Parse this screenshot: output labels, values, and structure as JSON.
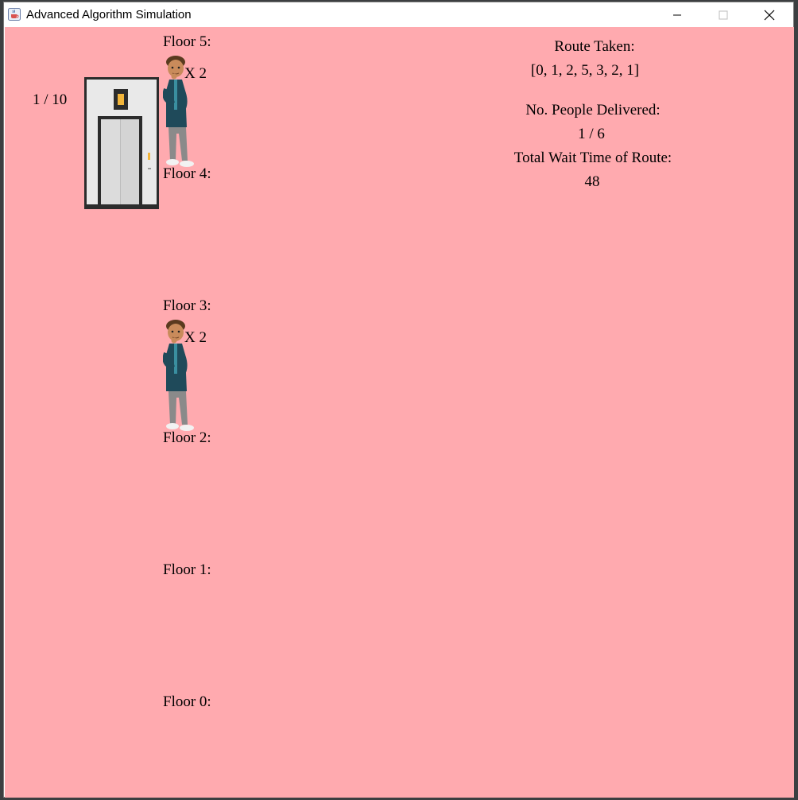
{
  "window": {
    "title": "Advanced Algorithm Simulation",
    "icon": "java-coffee-cup-icon",
    "controls": [
      "minimize-icon",
      "maximize-icon",
      "close-icon"
    ]
  },
  "simulation": {
    "background_color": "#ffaaaf",
    "elevator_capacity": "1 / 10",
    "elevator_floor": 5,
    "floors": [
      {
        "label": "Floor 5:",
        "waiting": "X 2"
      },
      {
        "label": "Floor 4:",
        "waiting": ""
      },
      {
        "label": "Floor 3:",
        "waiting": "X 2"
      },
      {
        "label": "Floor 2:",
        "waiting": ""
      },
      {
        "label": "Floor 1:",
        "waiting": ""
      },
      {
        "label": "Floor 0:",
        "waiting": ""
      }
    ]
  },
  "stats": {
    "route_label": "Route Taken:",
    "route_value": "[0, 1, 2, 5, 3, 2, 1]",
    "delivered_label": "No. People Delivered:",
    "delivered_value": "1 / 6",
    "wait_label": "Total Wait Time of Route:",
    "wait_value": "48"
  }
}
